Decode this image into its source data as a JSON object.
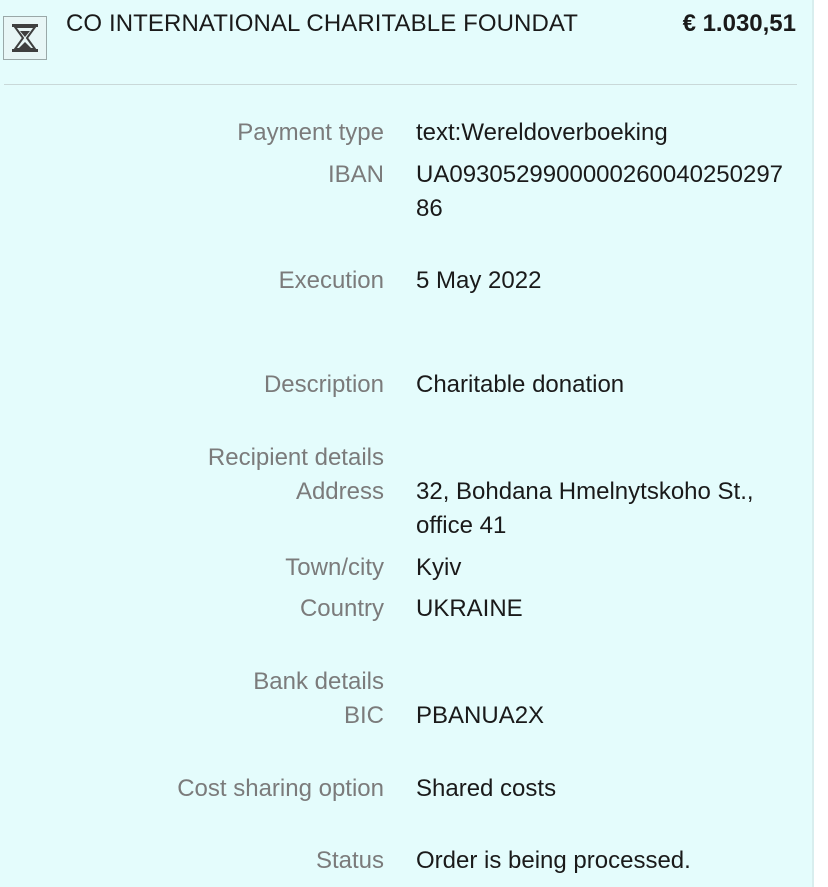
{
  "header": {
    "status_icon": "hourglass-icon",
    "recipient_name": "CO INTERNATIONAL CHARITABLE FOUNDAT",
    "amount": "€ 1.030,51"
  },
  "details": {
    "payment_type": {
      "label": "Payment type",
      "value": "text:Wereldoverboeking"
    },
    "iban": {
      "label": "IBAN",
      "value": "UA093052990000026004025029786"
    },
    "execution": {
      "label": "Execution",
      "value": "5 May 2022"
    },
    "description": {
      "label": "Description",
      "value": "Charitable donation"
    }
  },
  "recipient": {
    "title": "Recipient details",
    "address": {
      "label": "Address",
      "value": "32, Bohdana Hmelnytskoho St., office 41"
    },
    "town": {
      "label": "Town/city",
      "value": "Kyiv"
    },
    "country": {
      "label": "Country",
      "value": "UKRAINE"
    }
  },
  "bank": {
    "title": "Bank details",
    "bic": {
      "label": "BIC",
      "value": "PBANUA2X"
    }
  },
  "costs": {
    "label": "Cost sharing option",
    "value": "Shared costs"
  },
  "status": {
    "label": "Status",
    "value": "Order is being processed."
  },
  "colors": {
    "panel_bg": "#e4fcfc",
    "label_text": "#7b7b7b",
    "value_text": "#1a1a1a"
  }
}
